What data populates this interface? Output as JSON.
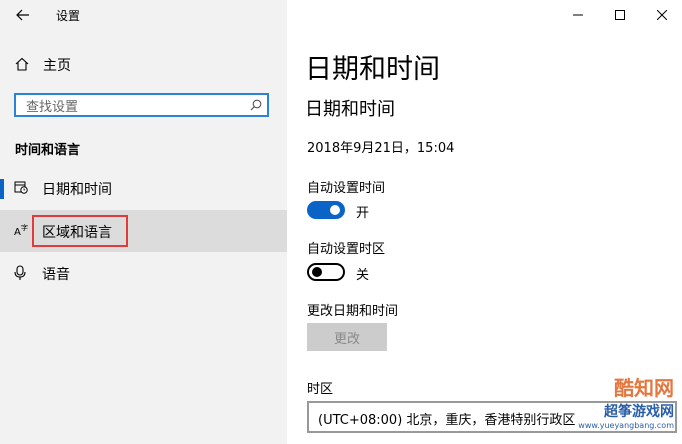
{
  "window": {
    "title": "设置"
  },
  "sidebar": {
    "home_label": "主页",
    "search_placeholder": "查找设置",
    "section_title": "时间和语言",
    "items": [
      {
        "label": "日期和时间",
        "icon": "calendar-clock-icon",
        "active": true
      },
      {
        "label": "区域和语言",
        "icon": "language-icon",
        "active": false,
        "hover": true
      },
      {
        "label": "语音",
        "icon": "microphone-icon",
        "active": false
      }
    ]
  },
  "main": {
    "page_title": "日期和时间",
    "sub_title": "日期和时间",
    "current_datetime": "2018年9月21日，15:04",
    "auto_time": {
      "label": "自动设置时间",
      "state_text": "开",
      "on": true
    },
    "auto_timezone": {
      "label": "自动设置时区",
      "state_text": "关",
      "on": false
    },
    "change": {
      "label": "更改日期和时间",
      "button": "更改"
    },
    "timezone": {
      "label": "时区",
      "value": "(UTC+08:00) 北京，重庆，香港特别行政区"
    }
  },
  "watermark": {
    "logo_text": "酷知网",
    "logo_text2": "超筝游戏网",
    "url": "www.yueyangbang.com"
  },
  "colors": {
    "accent": "#0a64c8",
    "sidebar_bg": "#f2f2f2",
    "highlight_box": "#e23b3b"
  }
}
